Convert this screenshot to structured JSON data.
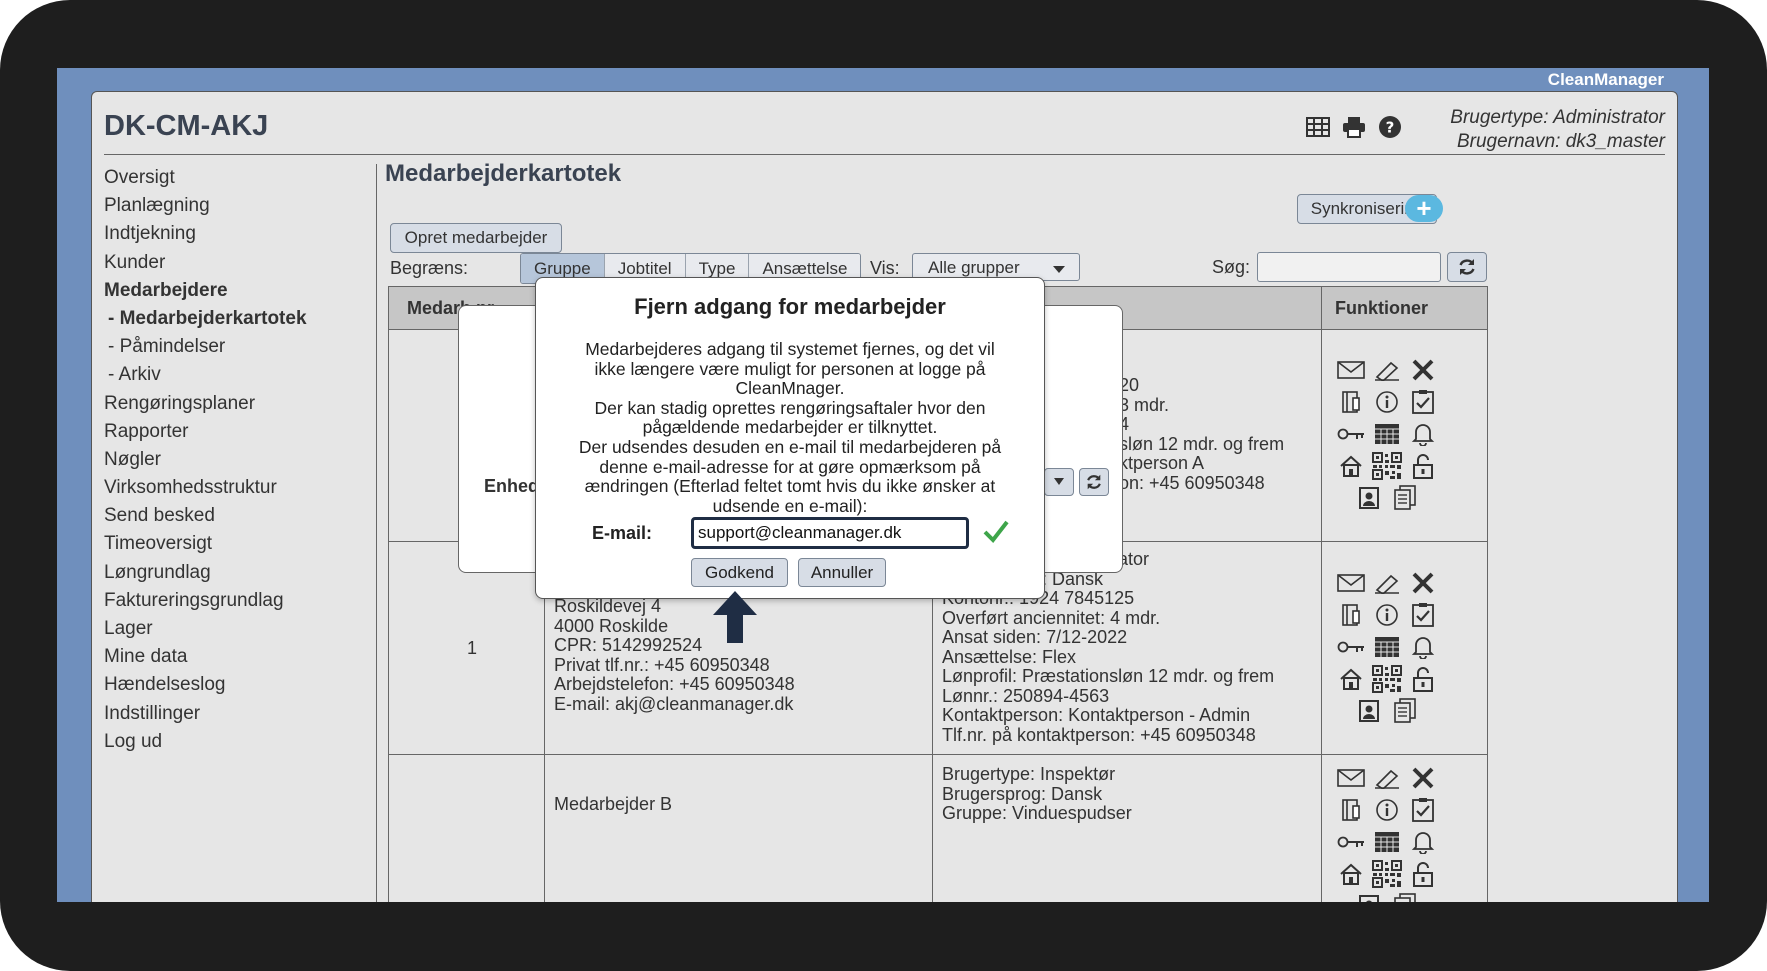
{
  "brand": "CleanManager",
  "app": {
    "title": "DK-CM-AKJ",
    "user_type": "Brugertype: Administrator",
    "user_name": "Brugernavn: dk3_master",
    "header_icons": [
      "table-icon",
      "printer-icon",
      "help-icon"
    ]
  },
  "menu": [
    {
      "label": "Oversigt"
    },
    {
      "label": "Planlægning"
    },
    {
      "label": "Indtjekning"
    },
    {
      "label": "Kunder"
    },
    {
      "label": "Medarbejdere",
      "active": true
    },
    {
      "label": "- Medarbejderkartotek",
      "active": true
    },
    {
      "label": "- Påmindelser"
    },
    {
      "label": "- Arkiv"
    },
    {
      "label": "Rengøringsplaner"
    },
    {
      "label": "Rapporter"
    },
    {
      "label": "Nøgler"
    },
    {
      "label": "Virksomhedsstruktur"
    },
    {
      "label": "Send besked"
    },
    {
      "label": "Timeoversigt"
    },
    {
      "label": "Løngrundlag"
    },
    {
      "label": "Faktureringsgrundlag"
    },
    {
      "label": "Lager"
    },
    {
      "label": "Mine data"
    },
    {
      "label": "Hændelseslog"
    },
    {
      "label": "Indstillinger"
    },
    {
      "label": "Log ud"
    }
  ],
  "page": {
    "title": "Medarbejderkartotek",
    "sync_label": "Synkronisering",
    "plus_label": "+",
    "create_label": "Opret medarbejder",
    "limit_label": "Begræns:",
    "filters": [
      {
        "label": "Gruppe",
        "active": true
      },
      {
        "label": "Jobtitel"
      },
      {
        "label": "Type"
      },
      {
        "label": "Ansættelse"
      }
    ],
    "show_label": "Vis:",
    "show_value": "Alle grupper",
    "search_label": "Søg:",
    "search_value": ""
  },
  "table": {
    "header_nr": "Medarb.nr.",
    "header_functions": "Funktioner",
    "row1": {
      "right": [
        "20",
        "3 mdr.",
        "4",
        "",
        "sløn 12 mdr. og frem",
        "",
        "ktperson A",
        "on: +45 60950348"
      ]
    },
    "row2": {
      "nr": "1",
      "left": [
        "Roskildevej 4",
        "4000 Roskilde",
        "CPR: 5142992524",
        "Privat tlf.nr.: +45 60950348",
        "Arbejdstelefon: +45 60950348",
        "E-mail: akj@cleanmanager.dk"
      ],
      "right": [
        "ator",
        ": Dansk",
        "Kontonr.: 1924 7845125",
        "Overført anciennitet: 4 mdr.",
        "Ansat siden: 7/12-2022",
        "Ansættelse: Flex",
        "Lønprofil: Præstationsløn 12 mdr. og frem",
        "Lønnr.: 250894-4563",
        "Kontaktperson: Kontaktperson - Admin",
        "Tlf.nr. på kontaktperson: +45 60950348"
      ]
    },
    "row3": {
      "left": [
        "Medarbejder B"
      ],
      "right": [
        "Brugertype: Inspektør",
        "Brugersprog: Dansk",
        "Gruppe: Vinduespudser"
      ]
    },
    "function_icons": [
      "mail-icon",
      "edit-icon",
      "delete-icon",
      "contract-icon",
      "info-icon",
      "checklist-icon",
      "key-icon",
      "calendar-icon",
      "bell-icon",
      "home-icon",
      "qr-code-icon",
      "unlock-icon",
      "id-card-icon",
      "document-icon"
    ]
  },
  "back_dialog": {
    "label": "Enhed"
  },
  "dialog": {
    "title": "Fjern adgang for medarbejder",
    "body": [
      "Medarbejderes adgang til systemet fjernes, og det vil",
      "ikke længere være muligt for personen at logge på",
      "CleanMnager.",
      "Der kan stadig oprettes rengøringsaftaler hvor den",
      "pågældende medarbejder er tilknyttet.",
      "Der udsendes desuden en e-mail til medarbejderen på",
      "denne e-mail-adresse for at gøre opmærksom på",
      "ændringen (Efterlad feltet tomt hvis du ikke ønsker at",
      "udsende en e-mail):"
    ],
    "email_label": "E-mail:",
    "email_value": "support@cleanmanager.dk",
    "approve_label": "Godkend",
    "cancel_label": "Annuller"
  },
  "colors": {
    "bezel": "#1e1e1e",
    "screen_bg": "#6f8fbd",
    "app_bg": "#e6e6e6",
    "button_bg": "#d7dde6",
    "active_segment": "#b6c6da",
    "plus_button": "#5bb8e0",
    "check_green": "#3ea54a",
    "arrow": "#1f2d44"
  }
}
